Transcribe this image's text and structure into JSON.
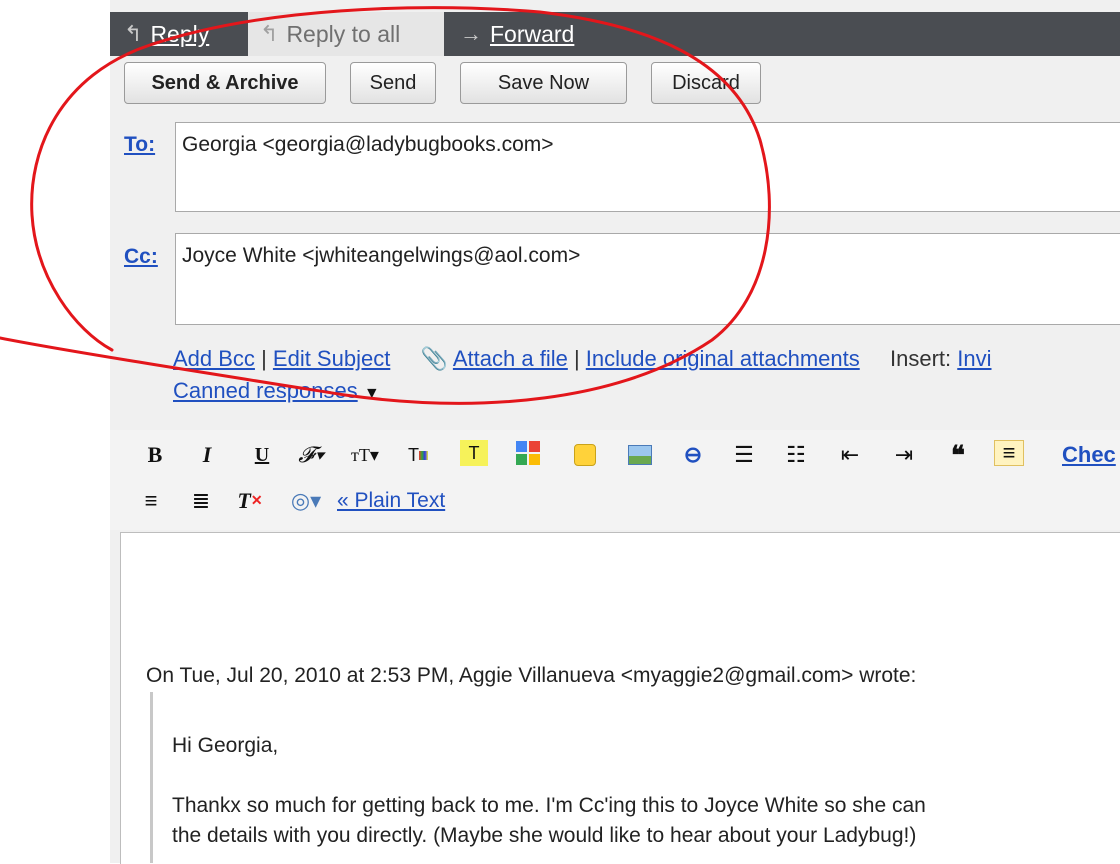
{
  "tabs": {
    "reply": "Reply",
    "reply_all": "Reply to all",
    "forward": "Forward"
  },
  "buttons": {
    "send_archive": "Send & Archive",
    "send": "Send",
    "save_now": "Save Now",
    "discard": "Discard"
  },
  "to": {
    "label": "To:",
    "value": "Georgia <georgia@ladybugbooks.com>"
  },
  "cc": {
    "label": "Cc:",
    "value": "Joyce White <jwhiteangelwings@aol.com>"
  },
  "links": {
    "add_bcc": "Add Bcc",
    "sep1": "|",
    "edit_subject": "Edit Subject",
    "attach_file": "Attach a file",
    "sep2": "|",
    "include_attachments": "Include original attachments",
    "insert_label": "Insert:",
    "insert_invite": "Invi",
    "canned_responses": "Canned responses",
    "canned_arrow": "▼"
  },
  "toolbar": {
    "bold": "B",
    "italic": "I",
    "underline": "U",
    "check": "Chec",
    "plain_text": "« Plain Text"
  },
  "message": {
    "attribution": "On Tue, Jul 20, 2010 at 2:53 PM, Aggie Villanueva <myaggie2@gmail.com> wrote:",
    "greeting": "Hi Georgia,",
    "body_line1": "Thankx so much for getting back to me. I'm Cc'ing this to Joyce White so she can",
    "body_line2": "the details with you directly. (Maybe she would like to hear about your Ladybug!)"
  },
  "colors": {
    "link": "#2050c0",
    "topbar": "#4a4d52",
    "annotation": "#e3161b"
  }
}
